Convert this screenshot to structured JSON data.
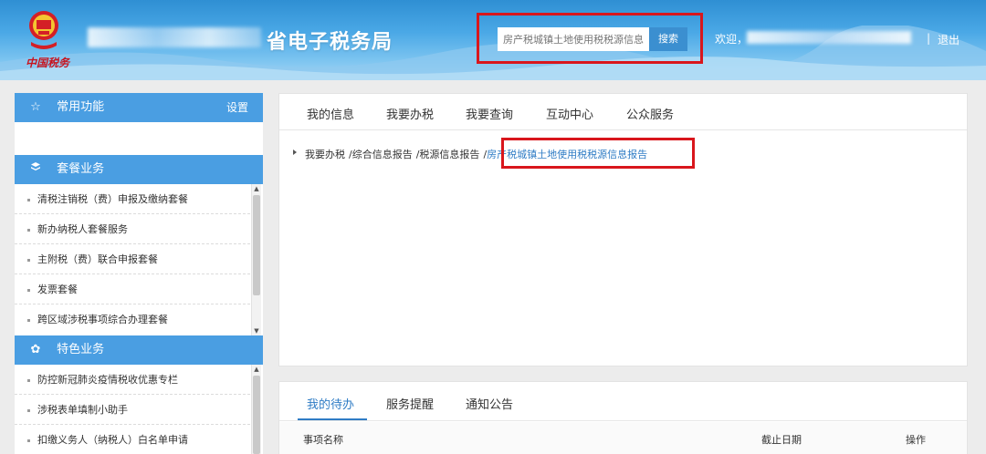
{
  "header": {
    "emblem_caption": "中国税务",
    "title_suffix": "省电子税务局",
    "search": {
      "placeholder": "房产税城镇土地使用税税源信息",
      "button": "搜索"
    },
    "welcome": "欢迎，",
    "separator": "|",
    "logout": "退出"
  },
  "sidebar": {
    "common": {
      "title": "常用功能",
      "settings": "设置",
      "icon": "star-icon"
    },
    "package": {
      "title": "套餐业务",
      "icon": "layers-icon",
      "items": [
        "清税注销税（费）申报及缴纳套餐",
        "新办纳税人套餐服务",
        "主附税（费）联合申报套餐",
        "发票套餐",
        "跨区域涉税事项综合办理套餐"
      ]
    },
    "special": {
      "title": "特色业务",
      "icon": "clover-icon",
      "items": [
        "防控新冠肺炎疫情税收优惠专栏",
        "涉税表单填制小助手",
        "扣缴义务人（纳税人）白名单申请"
      ]
    }
  },
  "main": {
    "tabs": [
      "我的信息",
      "我要办税",
      "我要查询",
      "互动中心",
      "公众服务"
    ],
    "breadcrumb": {
      "items": [
        "我要办税",
        "/综合信息报告",
        "/税源信息报告",
        "/"
      ],
      "current": "房产税城镇土地使用税税源信息报告"
    }
  },
  "todo": {
    "tabs": [
      "我的待办",
      "服务提醒",
      "通知公告"
    ],
    "columns": [
      "事项名称",
      "截止日期",
      "操作"
    ]
  },
  "colors": {
    "accent": "#4a9ee2",
    "highlight": "#d9161c",
    "link": "#2f7cc5"
  }
}
